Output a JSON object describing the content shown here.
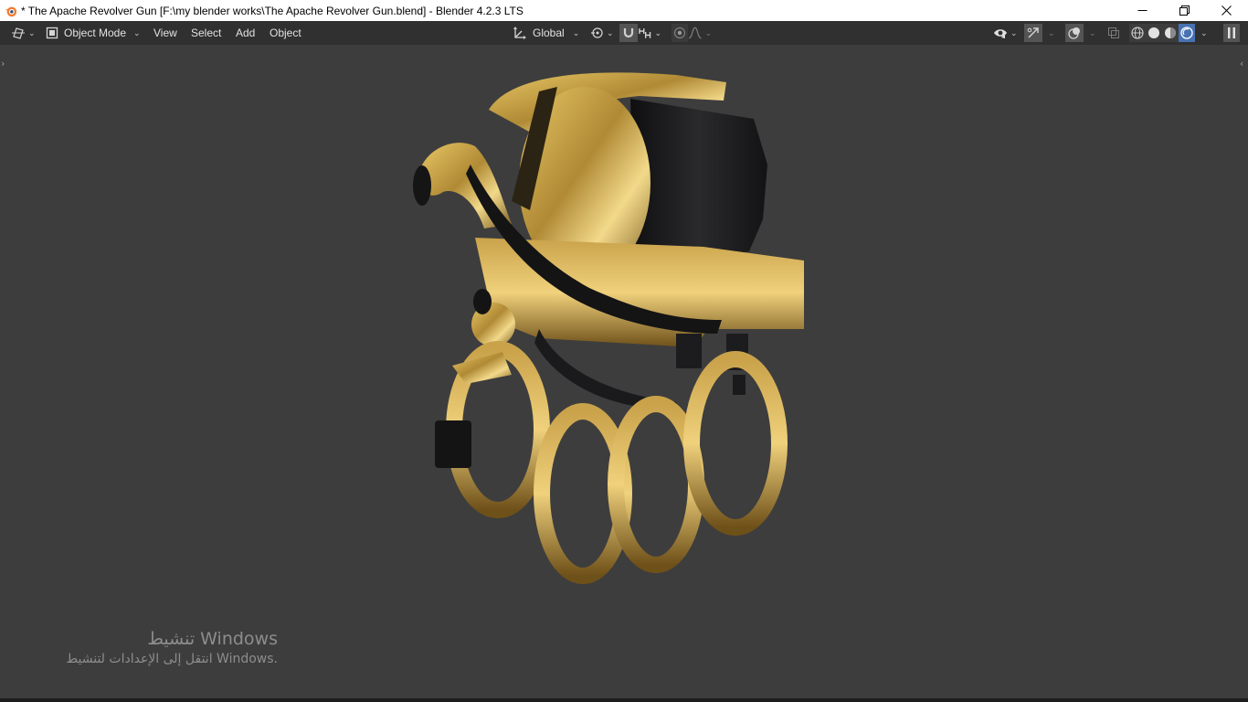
{
  "window": {
    "title": "* The Apache Revolver Gun [F:\\my blender works\\The Apache Revolver Gun.blend] - Blender 4.2.3 LTS",
    "controls": [
      "minimize-icon",
      "restore-icon",
      "close-icon"
    ]
  },
  "header": {
    "editor_type_icon": "viewport-editor-icon",
    "mode": {
      "label": "Object Mode",
      "icon": "object-mode-icon"
    },
    "menus": [
      "View",
      "Select",
      "Add",
      "Object"
    ],
    "transform_orientation": {
      "label": "Global",
      "icon": "orientation-icon"
    },
    "pivot_icon": "pivot-point-icon",
    "snap_icon": "snap-magnet-icon",
    "snap_target_icon": "snap-increment-icon",
    "proportional_edit_icon": "proportional-edit-icon",
    "falloff_icon": "falloff-curve-icon",
    "right_tools": [
      "visibility-eye-icon",
      "gizmo-icon",
      "overlays-icon",
      "xray-icon"
    ],
    "shading_modes": [
      {
        "name": "wireframe-shading-icon",
        "active": false
      },
      {
        "name": "solid-shading-icon",
        "active": false
      },
      {
        "name": "material-preview-icon",
        "active": false
      },
      {
        "name": "rendered-shading-icon",
        "active": true
      }
    ],
    "pause_icon": "pause-icon"
  },
  "viewport": {
    "background": "#3d3d3d",
    "object": "revolver-knuckle-model"
  },
  "watermark": {
    "line1": "تنشيط Windows",
    "line2": "انتقل إلى الإعدادات لتنشيط Windows."
  },
  "colors": {
    "header_bg": "#303030",
    "active_blue": "#4772b3",
    "brass": "#c9a24a",
    "steel_dark": "#1b1b1d"
  }
}
